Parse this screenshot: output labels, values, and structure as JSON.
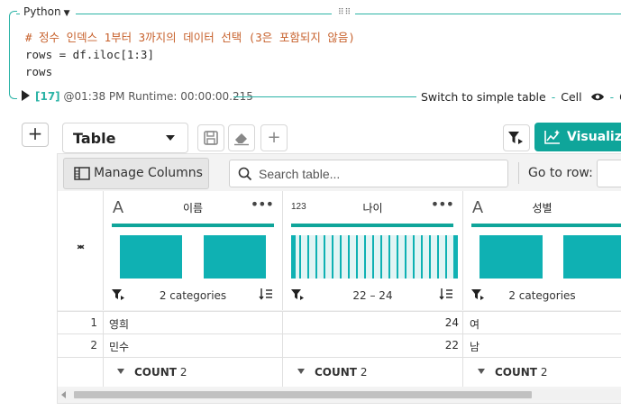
{
  "cell": {
    "language": "Python",
    "code_lines": [
      "# 정수 인덱스 1부터 3까지의 데이터 선택 (3은 포함되지 않음)",
      "rows = df.iloc[1:3]",
      "rows"
    ],
    "exec_count": "[17]",
    "meta": "@01:38 PM Runtime: 00:00:00.215",
    "switch_label": "Switch to simple table",
    "cell_label": "Cell",
    "output_label": "Ou"
  },
  "toolbar": {
    "view_label": "Table",
    "visualize_label": "Visualize"
  },
  "grid": {
    "manage_columns": "Manage Columns",
    "search_placeholder": "Search table...",
    "go_to_row": "Go to row:",
    "columns": [
      {
        "name": "이름",
        "type_icon": "A",
        "stat": "2 categories"
      },
      {
        "name": "나이",
        "type_icon": "123",
        "stat": "22 – 24"
      },
      {
        "name": "성별",
        "type_icon": "A",
        "stat": "2 categories"
      }
    ],
    "rows": [
      {
        "index": "1",
        "cells": [
          "영희",
          "24",
          "여"
        ]
      },
      {
        "index": "2",
        "cells": [
          "민수",
          "22",
          "남"
        ]
      }
    ],
    "count_label": "COUNT",
    "counts": [
      "2",
      "2",
      "2"
    ]
  },
  "colors": {
    "accent": "#0fa59a",
    "histogram": "#0fb1b3",
    "comment": "#c7612c"
  }
}
